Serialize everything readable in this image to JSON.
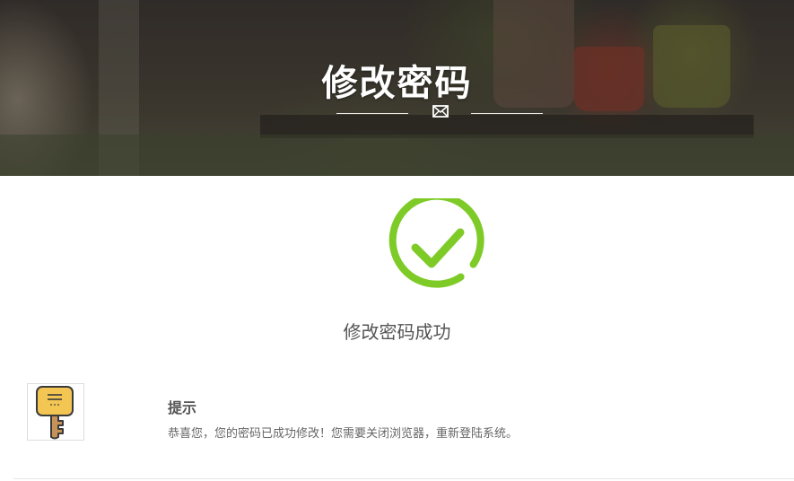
{
  "header": {
    "title": "修改密码",
    "icon": "mail-icon"
  },
  "result": {
    "icon": "success-check-icon",
    "accent_color": "#7ecb28",
    "message": "修改密码成功"
  },
  "notice": {
    "icon": "key-icon",
    "title": "提示",
    "text": "恭喜您，您的密码已成功修改！您需要关闭浏览器，重新登陆系统。"
  }
}
